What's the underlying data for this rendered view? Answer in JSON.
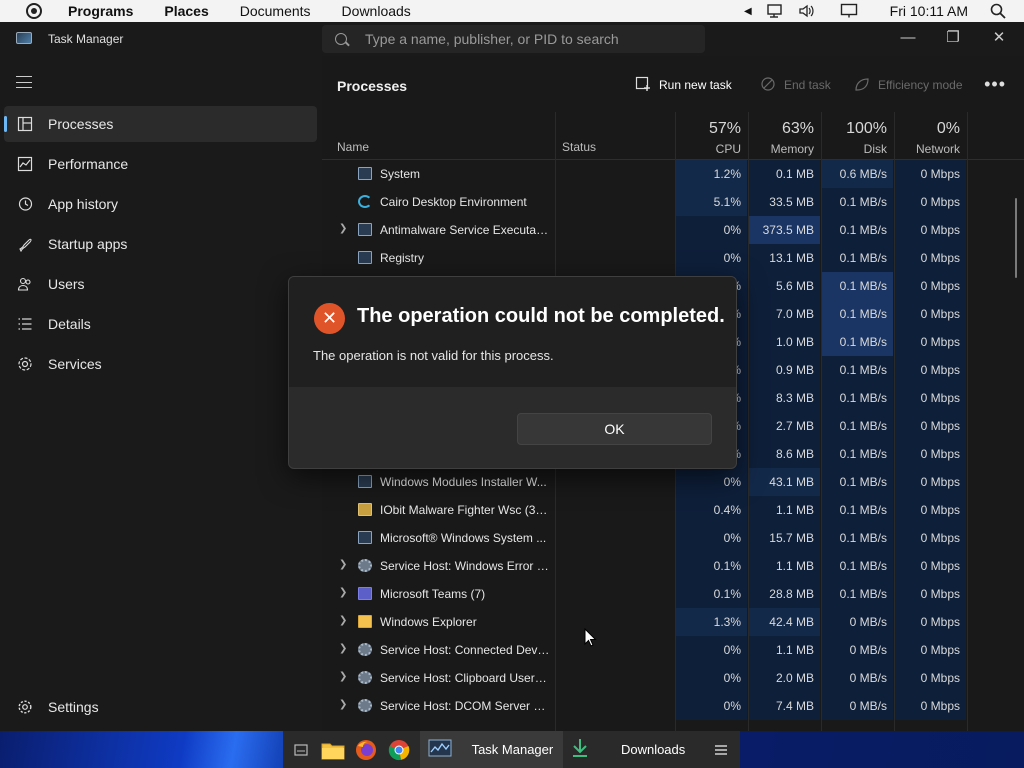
{
  "menubar": {
    "items": [
      "Programs",
      "Places",
      "Documents",
      "Downloads"
    ],
    "clock": "Fri 10:11 AM"
  },
  "window": {
    "title": "Task Manager",
    "search_placeholder": "Type a name, publisher, or PID to search"
  },
  "sidebar": {
    "items": [
      {
        "label": "Processes",
        "icon": "processes-icon"
      },
      {
        "label": "Performance",
        "icon": "performance-icon"
      },
      {
        "label": "App history",
        "icon": "app-history-icon"
      },
      {
        "label": "Startup apps",
        "icon": "startup-icon"
      },
      {
        "label": "Users",
        "icon": "users-icon"
      },
      {
        "label": "Details",
        "icon": "details-icon"
      },
      {
        "label": "Services",
        "icon": "services-icon"
      }
    ],
    "settings": "Settings"
  },
  "commandbar": {
    "title": "Processes",
    "run_new_task": "Run new task",
    "end_task": "End task",
    "efficiency_mode": "Efficiency mode"
  },
  "columns": {
    "name": "Name",
    "status": "Status",
    "cpu": {
      "pct": "57%",
      "label": "CPU"
    },
    "memory": {
      "pct": "63%",
      "label": "Memory"
    },
    "disk": {
      "pct": "100%",
      "label": "Disk"
    },
    "network": {
      "pct": "0%",
      "label": "Network"
    }
  },
  "processes": [
    {
      "name": "System",
      "expand": false,
      "icon": "window",
      "cpu": "1.2%",
      "mem": "0.1 MB",
      "disk": "0.6 MB/s",
      "net": "0 Mbps"
    },
    {
      "name": "Cairo Desktop Environment",
      "expand": false,
      "icon": "cairo",
      "cpu": "5.1%",
      "mem": "33.5 MB",
      "disk": "0.1 MB/s",
      "net": "0 Mbps"
    },
    {
      "name": "Antimalware Service Executable",
      "expand": true,
      "icon": "window",
      "cpu": "0%",
      "mem": "373.5 MB",
      "disk": "0.1 MB/s",
      "net": "0 Mbps"
    },
    {
      "name": "Registry",
      "expand": false,
      "icon": "window",
      "cpu": "0%",
      "mem": "13.1 MB",
      "disk": "0.1 MB/s",
      "net": "0 Mbps"
    },
    {
      "name": "",
      "expand": false,
      "icon": "window",
      "cpu": "%",
      "mem": "5.6 MB",
      "disk": "0.1 MB/s",
      "net": "0 Mbps"
    },
    {
      "name": "",
      "expand": false,
      "icon": "window",
      "cpu": "%",
      "mem": "7.0 MB",
      "disk": "0.1 MB/s",
      "net": "0 Mbps"
    },
    {
      "name": "",
      "expand": false,
      "icon": "window",
      "cpu": "%",
      "mem": "1.0 MB",
      "disk": "0.1 MB/s",
      "net": "0 Mbps"
    },
    {
      "name": "",
      "expand": false,
      "icon": "window",
      "cpu": "%",
      "mem": "0.9 MB",
      "disk": "0.1 MB/s",
      "net": "0 Mbps"
    },
    {
      "name": "",
      "expand": false,
      "icon": "window",
      "cpu": "%",
      "mem": "8.3 MB",
      "disk": "0.1 MB/s",
      "net": "0 Mbps"
    },
    {
      "name": "",
      "expand": false,
      "icon": "window",
      "cpu": "%",
      "mem": "2.7 MB",
      "disk": "0.1 MB/s",
      "net": "0 Mbps"
    },
    {
      "name": "",
      "expand": false,
      "icon": "window",
      "cpu": "%",
      "mem": "8.6 MB",
      "disk": "0.1 MB/s",
      "net": "0 Mbps"
    },
    {
      "name": "Windows Modules Installer W...",
      "expand": false,
      "icon": "window",
      "cpu": "0%",
      "mem": "43.1 MB",
      "disk": "0.1 MB/s",
      "net": "0 Mbps"
    },
    {
      "name": "IObit Malware Fighter Wsc (32...",
      "expand": false,
      "icon": "iobit",
      "cpu": "0.4%",
      "mem": "1.1 MB",
      "disk": "0.1 MB/s",
      "net": "0 Mbps"
    },
    {
      "name": "Microsoft® Windows System ...",
      "expand": false,
      "icon": "window",
      "cpu": "0%",
      "mem": "15.7 MB",
      "disk": "0.1 MB/s",
      "net": "0 Mbps"
    },
    {
      "name": "Service Host: Windows Error R...",
      "expand": true,
      "icon": "gear",
      "cpu": "0.1%",
      "mem": "1.1 MB",
      "disk": "0.1 MB/s",
      "net": "0 Mbps"
    },
    {
      "name": "Microsoft Teams (7)",
      "expand": true,
      "icon": "teams",
      "cpu": "0.1%",
      "mem": "28.8 MB",
      "disk": "0.1 MB/s",
      "net": "0 Mbps"
    },
    {
      "name": "Windows Explorer",
      "expand": true,
      "icon": "folder",
      "cpu": "1.3%",
      "mem": "42.4 MB",
      "disk": "0 MB/s",
      "net": "0 Mbps"
    },
    {
      "name": "Service Host: Connected Devi...",
      "expand": true,
      "icon": "gear",
      "cpu": "0%",
      "mem": "1.1 MB",
      "disk": "0 MB/s",
      "net": "0 Mbps"
    },
    {
      "name": "Service Host: Clipboard User S...",
      "expand": true,
      "icon": "gear",
      "cpu": "0%",
      "mem": "2.0 MB",
      "disk": "0 MB/s",
      "net": "0 Mbps"
    },
    {
      "name": "Service Host: DCOM Server Pr...",
      "expand": true,
      "icon": "gear",
      "cpu": "0%",
      "mem": "7.4 MB",
      "disk": "0 MB/s",
      "net": "0 Mbps"
    }
  ],
  "dialog": {
    "title": "The operation could not be completed.",
    "message": "The operation is not valid for this process.",
    "ok": "OK"
  },
  "taskbar": {
    "tasks": [
      "Task Manager",
      "Downloads"
    ]
  }
}
